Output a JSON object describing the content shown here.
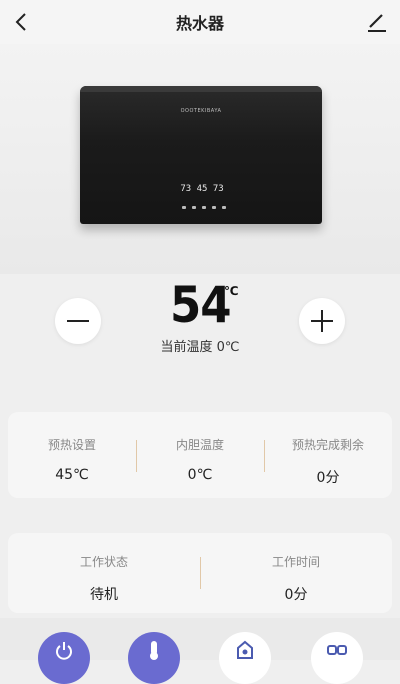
{
  "header": {
    "title": "热水器"
  },
  "device": {
    "brand": "OOOTEKIBAYA",
    "display": "73 45 73"
  },
  "temperature": {
    "value": "54",
    "unit": "℃",
    "current_label": "当前温度 0℃"
  },
  "info_card": [
    {
      "label": "预热设置",
      "value": "45℃"
    },
    {
      "label": "内胆温度",
      "value": "0℃"
    },
    {
      "label": "预热完成剩余",
      "value": "0分"
    }
  ],
  "status_card": [
    {
      "label": "工作状态",
      "value": "待机"
    },
    {
      "label": "工作时间",
      "value": "0分"
    }
  ],
  "tabs": [
    "power-icon",
    "thermometer-icon",
    "mode-icon",
    "grid-icon"
  ],
  "colors": {
    "accent": "#6a6bd0",
    "divider": "#e1c8a8"
  }
}
